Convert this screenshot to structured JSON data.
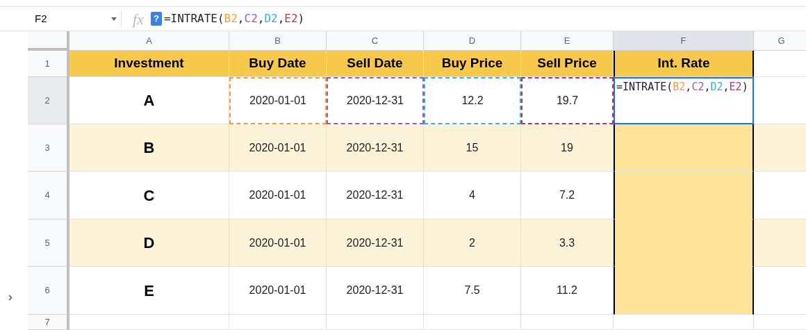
{
  "name_box": {
    "value": "F2"
  },
  "fx_label": "fx",
  "help_badge": "?",
  "formula_bar": {
    "parts": [
      {
        "text": "=INTRATE("
      },
      {
        "text": "B2",
        "color": "#f29b38"
      },
      {
        "text": ","
      },
      {
        "text": "C2",
        "color": "#9b59b6"
      },
      {
        "text": ","
      },
      {
        "text": "D2",
        "color": "#35b0d6"
      },
      {
        "text": ","
      },
      {
        "text": "E2",
        "color": "#b8325c"
      },
      {
        "text": ")"
      }
    ]
  },
  "columns": [
    {
      "label": "A",
      "selected": false
    },
    {
      "label": "B",
      "selected": false
    },
    {
      "label": "C",
      "selected": false
    },
    {
      "label": "D",
      "selected": false
    },
    {
      "label": "E",
      "selected": false
    },
    {
      "label": "F",
      "selected": true
    },
    {
      "label": "G",
      "selected": false
    }
  ],
  "rows": [
    {
      "number": "1",
      "selected": false,
      "kind": "header",
      "cells": [
        {
          "text": "Investment"
        },
        {
          "text": "Buy Date"
        },
        {
          "text": "Sell Date"
        },
        {
          "text": "Buy Price"
        },
        {
          "text": "Sell Price"
        },
        {
          "text": "Int. Rate"
        }
      ]
    },
    {
      "number": "2",
      "selected": true,
      "kind": "data",
      "cells": [
        {
          "text": "A"
        },
        {
          "text": "2020-01-01",
          "color": "#f29b38"
        },
        {
          "text": "2020-12-31",
          "color": "#9b59b6"
        },
        {
          "text": "12.2",
          "color": "#35b0d6"
        },
        {
          "text": "19.7",
          "color": "#b8325c"
        },
        {
          "kind": "editing",
          "parts": [
            {
              "text": "=INTRATE("
            },
            {
              "text": "B2",
              "color": "#f29b38"
            },
            {
              "text": ","
            },
            {
              "text": "C2",
              "color": "#9b59b6"
            },
            {
              "text": ","
            },
            {
              "text": "D2",
              "color": "#35b0d6"
            },
            {
              "text": ","
            },
            {
              "text": "E2",
              "color": "#b8325c"
            },
            {
              "text": ")"
            }
          ]
        }
      ]
    },
    {
      "number": "3",
      "selected": false,
      "kind": "data",
      "cells": [
        {
          "text": "B"
        },
        {
          "text": "2020-01-01"
        },
        {
          "text": "2020-12-31"
        },
        {
          "text": "15"
        },
        {
          "text": "19"
        },
        {}
      ]
    },
    {
      "number": "4",
      "selected": false,
      "kind": "data",
      "cells": [
        {
          "text": "C"
        },
        {
          "text": "2020-01-01"
        },
        {
          "text": "2020-12-31"
        },
        {
          "text": "4"
        },
        {
          "text": "7.2"
        },
        {}
      ]
    },
    {
      "number": "5",
      "selected": false,
      "kind": "data",
      "cells": [
        {
          "text": "D"
        },
        {
          "text": "2020-01-01"
        },
        {
          "text": "2020-12-31"
        },
        {
          "text": "2"
        },
        {
          "text": "3.3"
        },
        {}
      ]
    },
    {
      "number": "6",
      "selected": false,
      "kind": "data",
      "cells": [
        {
          "text": "E"
        },
        {
          "text": "2020-01-01"
        },
        {
          "text": "2020-12-31"
        },
        {
          "text": "7.5"
        },
        {
          "text": "11.2"
        },
        {}
      ]
    },
    {
      "number": "7",
      "selected": false,
      "kind": "empty",
      "cells": []
    }
  ]
}
